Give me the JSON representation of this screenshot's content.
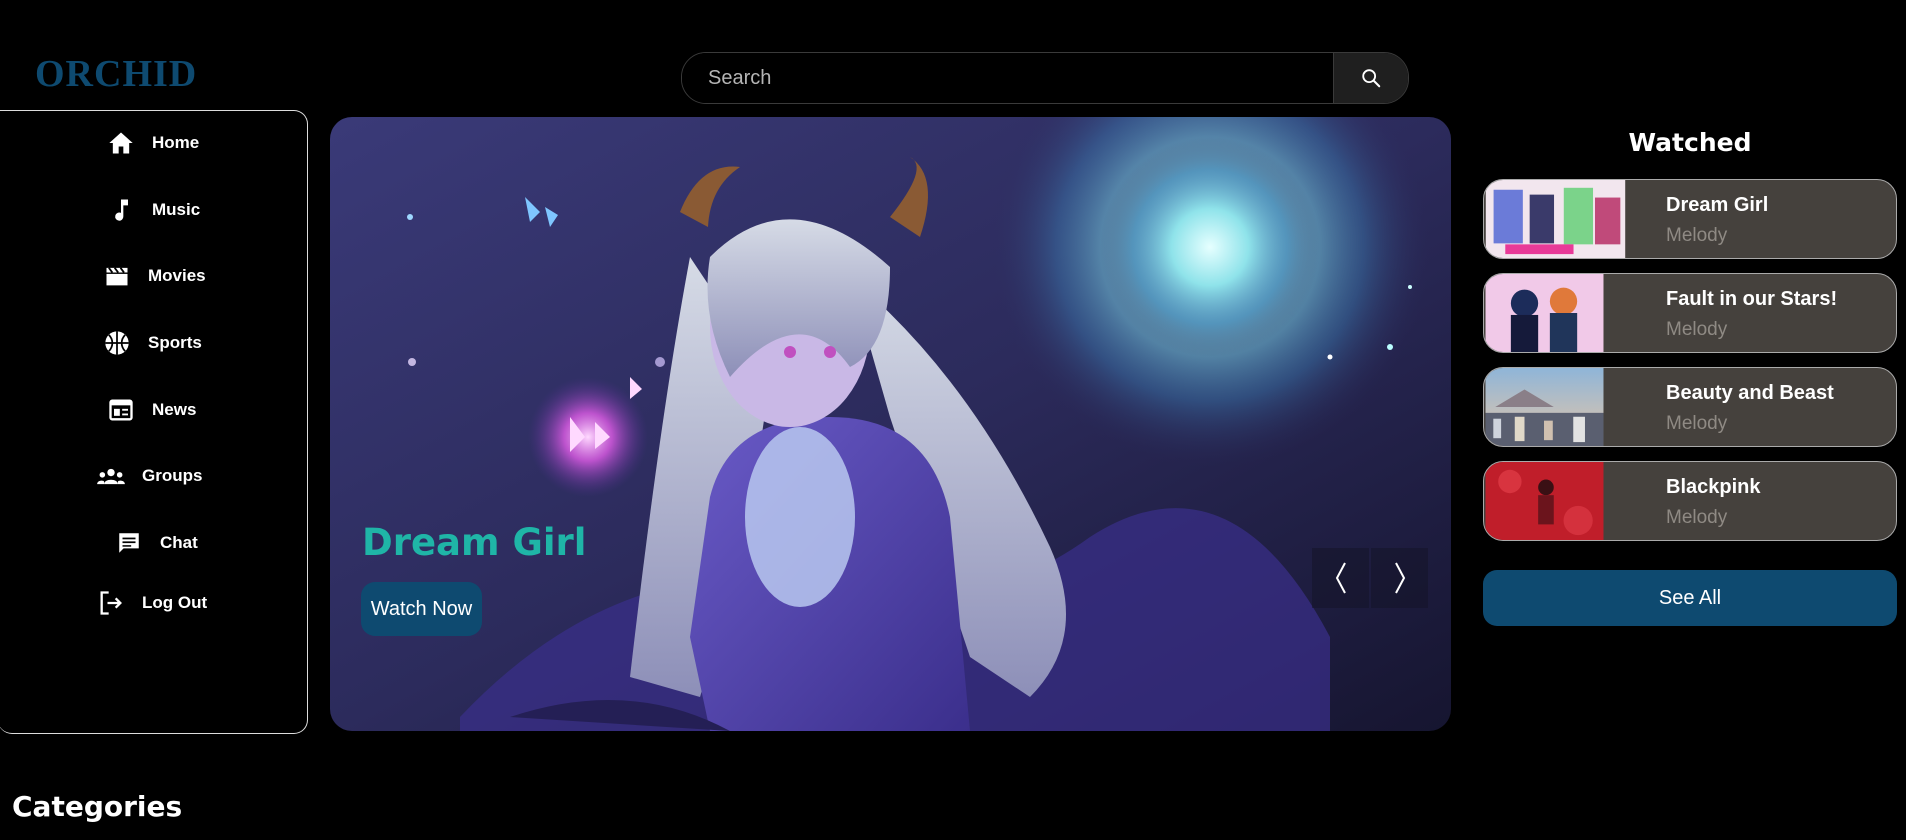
{
  "brand": {
    "logo": "ORCHID"
  },
  "search": {
    "placeholder": "Search",
    "icon": "search-icon"
  },
  "sidebar": {
    "items": [
      {
        "label": "Home",
        "icon": "home-icon"
      },
      {
        "label": "Music",
        "icon": "music-note-icon"
      },
      {
        "label": "Movies",
        "icon": "clapperboard-icon"
      },
      {
        "label": "Sports",
        "icon": "basketball-icon"
      },
      {
        "label": "News",
        "icon": "newspaper-icon"
      },
      {
        "label": "Groups",
        "icon": "groups-icon"
      },
      {
        "label": "Chat",
        "icon": "chat-icon"
      },
      {
        "label": "Log Out",
        "icon": "logout-icon"
      }
    ]
  },
  "hero": {
    "title": "Dream Girl",
    "button": "Watch Now",
    "prev_icon": "chevron-left-icon",
    "next_icon": "chevron-right-icon"
  },
  "watched": {
    "title": "Watched",
    "items": [
      {
        "title": "Dream Girl",
        "subtitle": "Melody"
      },
      {
        "title": "Fault in our Stars!",
        "subtitle": "Melody"
      },
      {
        "title": "Beauty and Beast",
        "subtitle": "Melody"
      },
      {
        "title": "Blackpink",
        "subtitle": "Melody"
      }
    ],
    "see_all": "See All"
  },
  "categories": {
    "title": "Categories"
  },
  "colors": {
    "brand": "#0e4a70",
    "accent_title": "#1fb5a7",
    "card_bg": "#45413d"
  }
}
